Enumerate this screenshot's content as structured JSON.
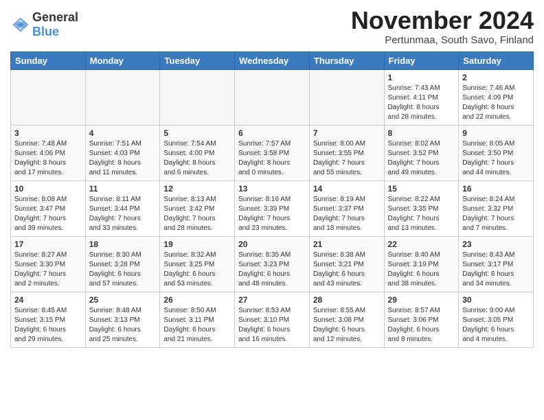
{
  "logo": {
    "line1": "General",
    "line2": "Blue"
  },
  "title": "November 2024",
  "subtitle": "Pertunmaa, South Savo, Finland",
  "weekdays": [
    "Sunday",
    "Monday",
    "Tuesday",
    "Wednesday",
    "Thursday",
    "Friday",
    "Saturday"
  ],
  "weeks": [
    [
      {
        "day": "",
        "info": ""
      },
      {
        "day": "",
        "info": ""
      },
      {
        "day": "",
        "info": ""
      },
      {
        "day": "",
        "info": ""
      },
      {
        "day": "",
        "info": ""
      },
      {
        "day": "1",
        "info": "Sunrise: 7:43 AM\nSunset: 4:11 PM\nDaylight: 8 hours\nand 28 minutes."
      },
      {
        "day": "2",
        "info": "Sunrise: 7:46 AM\nSunset: 4:09 PM\nDaylight: 8 hours\nand 22 minutes."
      }
    ],
    [
      {
        "day": "3",
        "info": "Sunrise: 7:48 AM\nSunset: 4:06 PM\nDaylight: 8 hours\nand 17 minutes."
      },
      {
        "day": "4",
        "info": "Sunrise: 7:51 AM\nSunset: 4:03 PM\nDaylight: 8 hours\nand 11 minutes."
      },
      {
        "day": "5",
        "info": "Sunrise: 7:54 AM\nSunset: 4:00 PM\nDaylight: 8 hours\nand 6 minutes."
      },
      {
        "day": "6",
        "info": "Sunrise: 7:57 AM\nSunset: 3:58 PM\nDaylight: 8 hours\nand 0 minutes."
      },
      {
        "day": "7",
        "info": "Sunrise: 8:00 AM\nSunset: 3:55 PM\nDaylight: 7 hours\nand 55 minutes."
      },
      {
        "day": "8",
        "info": "Sunrise: 8:02 AM\nSunset: 3:52 PM\nDaylight: 7 hours\nand 49 minutes."
      },
      {
        "day": "9",
        "info": "Sunrise: 8:05 AM\nSunset: 3:50 PM\nDaylight: 7 hours\nand 44 minutes."
      }
    ],
    [
      {
        "day": "10",
        "info": "Sunrise: 8:08 AM\nSunset: 3:47 PM\nDaylight: 7 hours\nand 39 minutes."
      },
      {
        "day": "11",
        "info": "Sunrise: 8:11 AM\nSunset: 3:44 PM\nDaylight: 7 hours\nand 33 minutes."
      },
      {
        "day": "12",
        "info": "Sunrise: 8:13 AM\nSunset: 3:42 PM\nDaylight: 7 hours\nand 28 minutes."
      },
      {
        "day": "13",
        "info": "Sunrise: 8:16 AM\nSunset: 3:39 PM\nDaylight: 7 hours\nand 23 minutes."
      },
      {
        "day": "14",
        "info": "Sunrise: 8:19 AM\nSunset: 3:37 PM\nDaylight: 7 hours\nand 18 minutes."
      },
      {
        "day": "15",
        "info": "Sunrise: 8:22 AM\nSunset: 3:35 PM\nDaylight: 7 hours\nand 13 minutes."
      },
      {
        "day": "16",
        "info": "Sunrise: 8:24 AM\nSunset: 3:32 PM\nDaylight: 7 hours\nand 7 minutes."
      }
    ],
    [
      {
        "day": "17",
        "info": "Sunrise: 8:27 AM\nSunset: 3:30 PM\nDaylight: 7 hours\nand 2 minutes."
      },
      {
        "day": "18",
        "info": "Sunrise: 8:30 AM\nSunset: 3:28 PM\nDaylight: 6 hours\nand 57 minutes."
      },
      {
        "day": "19",
        "info": "Sunrise: 8:32 AM\nSunset: 3:25 PM\nDaylight: 6 hours\nand 53 minutes."
      },
      {
        "day": "20",
        "info": "Sunrise: 8:35 AM\nSunset: 3:23 PM\nDaylight: 6 hours\nand 48 minutes."
      },
      {
        "day": "21",
        "info": "Sunrise: 8:38 AM\nSunset: 3:21 PM\nDaylight: 6 hours\nand 43 minutes."
      },
      {
        "day": "22",
        "info": "Sunrise: 8:40 AM\nSunset: 3:19 PM\nDaylight: 6 hours\nand 38 minutes."
      },
      {
        "day": "23",
        "info": "Sunrise: 8:43 AM\nSunset: 3:17 PM\nDaylight: 6 hours\nand 34 minutes."
      }
    ],
    [
      {
        "day": "24",
        "info": "Sunrise: 8:45 AM\nSunset: 3:15 PM\nDaylight: 6 hours\nand 29 minutes."
      },
      {
        "day": "25",
        "info": "Sunrise: 8:48 AM\nSunset: 3:13 PM\nDaylight: 6 hours\nand 25 minutes."
      },
      {
        "day": "26",
        "info": "Sunrise: 8:50 AM\nSunset: 3:11 PM\nDaylight: 6 hours\nand 21 minutes."
      },
      {
        "day": "27",
        "info": "Sunrise: 8:53 AM\nSunset: 3:10 PM\nDaylight: 6 hours\nand 16 minutes."
      },
      {
        "day": "28",
        "info": "Sunrise: 8:55 AM\nSunset: 3:08 PM\nDaylight: 6 hours\nand 12 minutes."
      },
      {
        "day": "29",
        "info": "Sunrise: 8:57 AM\nSunset: 3:06 PM\nDaylight: 6 hours\nand 8 minutes."
      },
      {
        "day": "30",
        "info": "Sunrise: 9:00 AM\nSunset: 3:05 PM\nDaylight: 6 hours\nand 4 minutes."
      }
    ]
  ]
}
